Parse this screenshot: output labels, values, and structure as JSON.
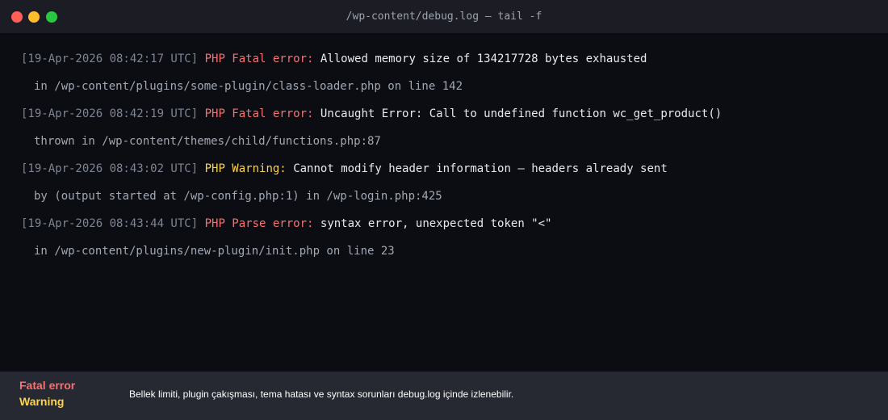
{
  "window": {
    "title": "/wp-content/debug.log — tail -f"
  },
  "colors": {
    "fatal": "#f87171",
    "warning": "#fcd34d",
    "timestamp": "#7d8594"
  },
  "log": [
    {
      "timestamp": "[19-Apr-2026 08:42:17 UTC]",
      "level": "PHP Fatal error:",
      "message": "Allowed memory size of 134217728 bytes exhausted",
      "detail": "in /wp-content/plugins/some-plugin/class-loader.php on line 142"
    },
    {
      "timestamp": "[19-Apr-2026 08:42:19 UTC]",
      "level": "PHP Fatal error:",
      "message": "Uncaught Error: Call to undefined function wc_get_product()",
      "detail": "thrown in /wp-content/themes/child/functions.php:87"
    },
    {
      "timestamp": "[19-Apr-2026 08:43:02 UTC]",
      "level": "PHP Warning:",
      "message": "Cannot modify header information — headers already sent",
      "detail": "by (output started at /wp-config.php:1) in /wp-login.php:425"
    },
    {
      "timestamp": "[19-Apr-2026 08:43:44 UTC]",
      "level": "PHP Parse error:",
      "message": "syntax error, unexpected token \"<\"",
      "detail": "in /wp-content/plugins/new-plugin/init.php on line 23"
    }
  ],
  "footer": {
    "legend_fatal": "Fatal error",
    "legend_warning": "Warning",
    "note": "Bellek limiti, plugin çakışması, tema hatası ve syntax sorunları debug.log içinde izlenebilir."
  }
}
